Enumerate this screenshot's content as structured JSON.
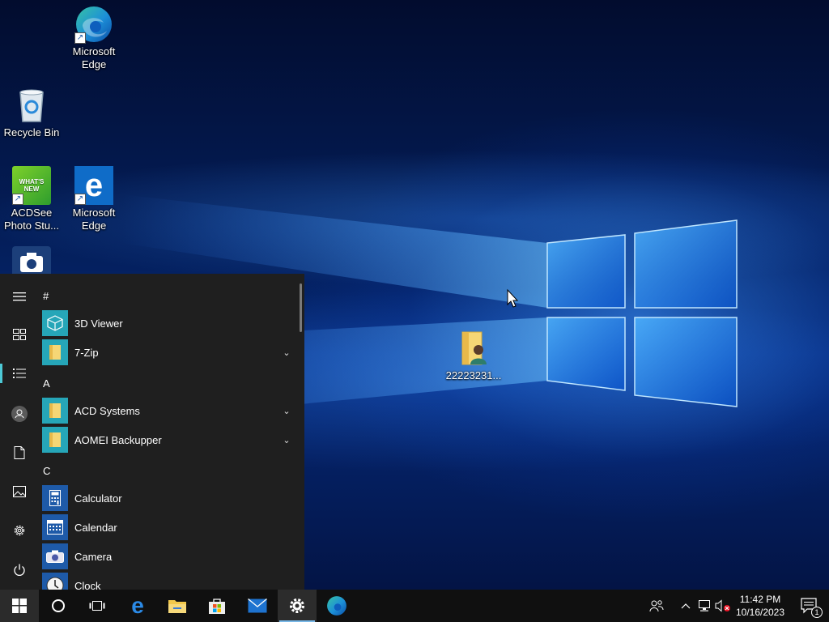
{
  "desktop": {
    "icons": [
      {
        "label": "Microsoft Edge",
        "icon": "edge-chromium-icon"
      },
      {
        "label": "Recycle Bin",
        "icon": "recycle-bin-icon"
      },
      {
        "label": "ACDSee Photo Stu...",
        "icon": "acdsee-icon",
        "badge": "WHAT'S NEW"
      },
      {
        "label": "Microsoft Edge",
        "icon": "edge-legacy-icon"
      },
      {
        "label": "",
        "icon": "camera-app-icon"
      },
      {
        "label": "22223231...",
        "icon": "user-folder-icon"
      }
    ]
  },
  "start_menu": {
    "rail": [
      {
        "name": "expand",
        "icon": "hamburger-icon"
      },
      {
        "name": "tiles",
        "icon": "tiles-icon"
      },
      {
        "name": "all-apps",
        "icon": "list-icon"
      },
      {
        "name": "account",
        "icon": "user-avatar-icon"
      },
      {
        "name": "documents",
        "icon": "document-icon"
      },
      {
        "name": "pictures",
        "icon": "pictures-icon"
      },
      {
        "name": "settings",
        "icon": "gear-icon"
      },
      {
        "name": "power",
        "icon": "power-icon"
      }
    ],
    "groups": [
      {
        "letter": "#",
        "apps": [
          {
            "label": "3D Viewer",
            "icon": "cube-icon"
          },
          {
            "label": "7-Zip",
            "icon": "folder-icon",
            "expandable": true
          }
        ]
      },
      {
        "letter": "A",
        "apps": [
          {
            "label": "ACD Systems",
            "icon": "folder-icon",
            "expandable": true
          },
          {
            "label": "AOMEI Backupper",
            "icon": "folder-icon",
            "expandable": true
          }
        ]
      },
      {
        "letter": "C",
        "apps": [
          {
            "label": "Calculator",
            "icon": "calculator-icon"
          },
          {
            "label": "Calendar",
            "icon": "calendar-icon"
          },
          {
            "label": "Camera",
            "icon": "camera-icon"
          },
          {
            "label": "Clock",
            "icon": "clock-icon"
          }
        ]
      }
    ]
  },
  "taskbar": {
    "pinned": [
      {
        "name": "start",
        "icon": "windows-logo-icon"
      },
      {
        "name": "search",
        "icon": "cortana-circle-icon"
      },
      {
        "name": "task-view",
        "icon": "task-view-icon"
      },
      {
        "name": "edge-legacy",
        "icon": "edge-legacy-icon"
      },
      {
        "name": "file-explorer",
        "icon": "file-explorer-icon"
      },
      {
        "name": "store",
        "icon": "store-icon"
      },
      {
        "name": "mail",
        "icon": "mail-icon"
      },
      {
        "name": "settings",
        "icon": "gear-icon",
        "running": true
      },
      {
        "name": "edge",
        "icon": "edge-chromium-icon"
      }
    ],
    "tray": [
      {
        "name": "people",
        "icon": "people-icon"
      },
      {
        "name": "show-hidden",
        "icon": "chevron-up-icon"
      },
      {
        "name": "network",
        "icon": "network-icon"
      },
      {
        "name": "volume",
        "icon": "volume-muted-icon"
      }
    ],
    "clock": {
      "time": "11:42 PM",
      "date": "10/16/2023"
    },
    "notifications": {
      "count": "1"
    }
  },
  "colors": {
    "start_bg": "#1f1f1f",
    "taskbar_bg": "#101010",
    "tile_accent": "#26a6b8",
    "tile_blue": "#1e5aa8",
    "rail_accent": "#4dc9d6"
  }
}
